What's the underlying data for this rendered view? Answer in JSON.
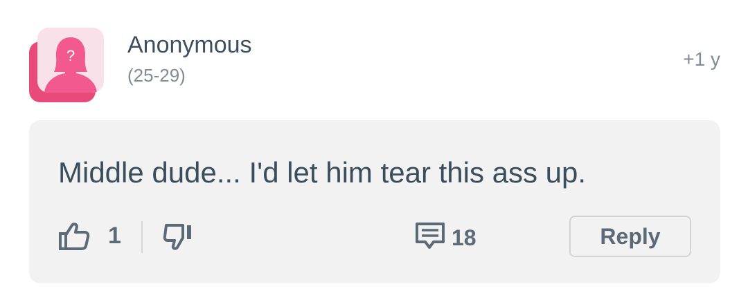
{
  "author": {
    "name": "Anonymous",
    "age_range": "(25-29)",
    "avatar_icon": "anonymous-woman-icon",
    "avatar_question": "?"
  },
  "post_time": "+1 y",
  "comment": {
    "text": "Middle dude... I'd let him tear this ass up."
  },
  "actions": {
    "like_icon": "thumbs-up-icon",
    "like_count": "1",
    "dislike_icon": "thumbs-down-icon",
    "comments_icon": "comment-bubble-icon",
    "comments_count": "18",
    "reply_label": "Reply"
  },
  "colors": {
    "avatar_accent": "#f25a8f",
    "avatar_shadow": "#e84a7a",
    "avatar_bg": "#f9e1ea",
    "card_bg": "#f2f2f2",
    "icon_gray": "#5b6a76"
  }
}
